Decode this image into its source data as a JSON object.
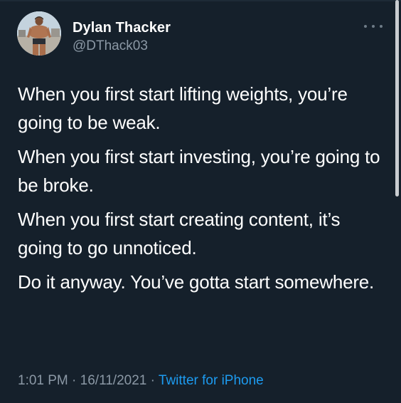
{
  "author": {
    "display_name": "Dylan Thacker",
    "handle": "@DThack03",
    "avatar_icon": "profile-photo"
  },
  "tweet": {
    "paragraphs": [
      "When you first start lifting weights, you’re going to be weak.",
      "When you first start investing, you’re going to be broke.",
      "When you first start creating content, it’s going to go unnoticed.",
      "Do it anyway. You’ve gotta start somewhere."
    ]
  },
  "meta": {
    "time": "1:01 PM",
    "separator": "·",
    "date": "16/11/2021",
    "source": "Twitter for iPhone"
  },
  "menu": {
    "icon": "more-horizontal-icon"
  },
  "colors": {
    "background": "#15202b",
    "text": "#ffffff",
    "secondary": "#8b98a5",
    "link": "#1d9bf0"
  }
}
